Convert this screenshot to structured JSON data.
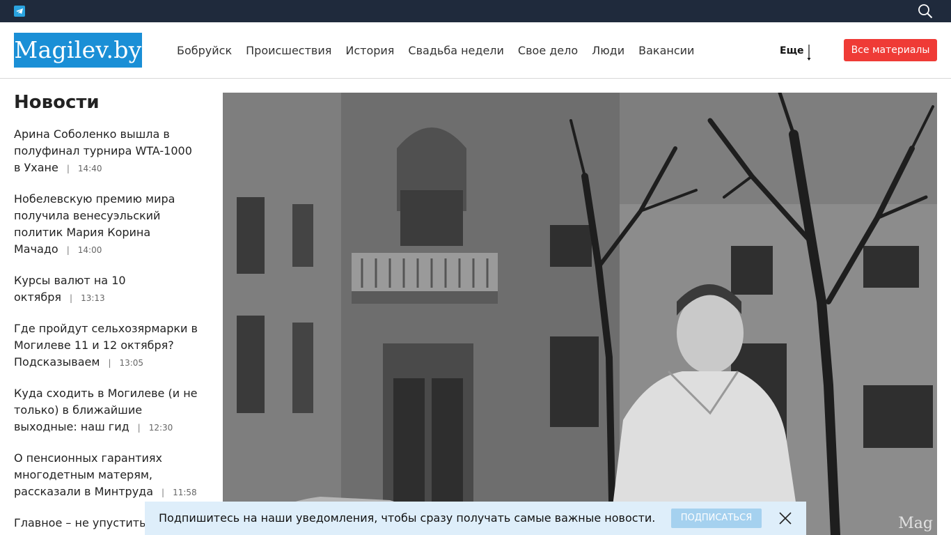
{
  "topbar": {
    "telegram_icon": "telegram-icon",
    "search_icon": "search-icon"
  },
  "header": {
    "logo": "Magilev.by",
    "nav": [
      "Бобруйск",
      "Происшествия",
      "История",
      "Свадьба недели",
      "Свое дело",
      "Люди",
      "Вакансии"
    ],
    "more_label": "Еще",
    "all_materials_label": "Все материалы"
  },
  "sidebar": {
    "title": "Новости",
    "items": [
      {
        "title": "Арина Соболенко вышла в полуфинал турнира WTA-1000 в Ухане",
        "sep": "|",
        "time": "14:40"
      },
      {
        "title": "Нобелевскую премию мира получила венесуэльский политик Мария Корина Мачадо",
        "sep": "|",
        "time": "14:00"
      },
      {
        "title": "Курсы валют на 10 октября",
        "sep": "|",
        "time": "13:13"
      },
      {
        "title": "Где пройдут сельхозярмарки в Могилеве 11 и 12 октября? Подсказываем",
        "sep": "|",
        "time": "13:05"
      },
      {
        "title": "Куда сходить в Могилеве (и не только) в ближайшие выходные: наш гид",
        "sep": "|",
        "time": "12:30"
      },
      {
        "title": "О пенсионных гарантиях многодетным матерям, рассказали в Минтруда",
        "sep": "|",
        "time": "11:58"
      },
      {
        "title": "Главное – не упустить мо",
        "sep": "",
        "time": ""
      }
    ]
  },
  "hero": {
    "watermark": "Mag"
  },
  "notification": {
    "text": "Подпишитесь на наши уведомления, чтобы сразу получать самые важные новости.",
    "subscribe_label": "ПОДПИСАТЬСЯ"
  },
  "colors": {
    "topbar": "#1f2a3c",
    "logo_bg": "#1a8fd6",
    "button_red": "#ef3b36",
    "notify_bg": "#deeefa",
    "subscribe_bg": "#a5d1ef"
  }
}
